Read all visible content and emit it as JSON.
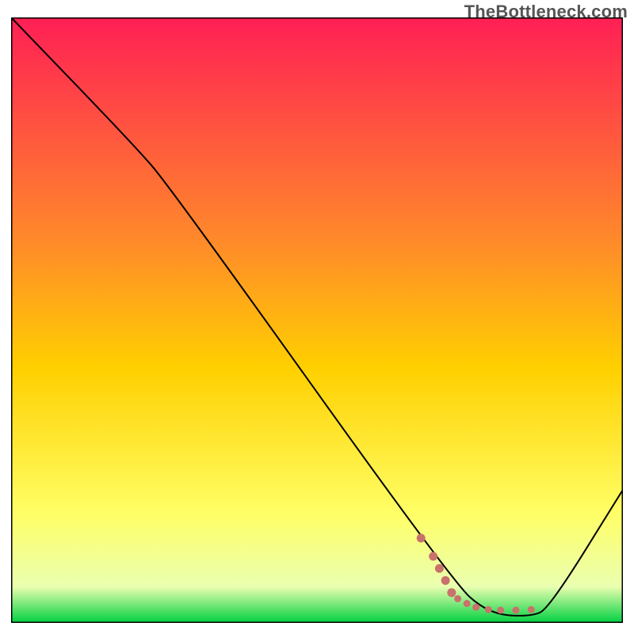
{
  "watermark": "TheBottleneck.com",
  "chart_data": {
    "type": "line",
    "title": "",
    "xlabel": "",
    "ylabel": "",
    "xlim": [
      0,
      100
    ],
    "ylim": [
      0,
      100
    ],
    "grid": false,
    "legend": null,
    "background_gradient": {
      "top": "#ff1f55",
      "mid": "#ffd000",
      "low": "#ffff66",
      "bottom": "#00d040"
    },
    "series": [
      {
        "name": "bottleneck-curve",
        "stroke": "#000000",
        "points": [
          {
            "x": 0,
            "y": 100
          },
          {
            "x": 20,
            "y": 79
          },
          {
            "x": 26,
            "y": 72
          },
          {
            "x": 72,
            "y": 7
          },
          {
            "x": 78,
            "y": 1.5
          },
          {
            "x": 85,
            "y": 1.0
          },
          {
            "x": 88,
            "y": 2.5
          },
          {
            "x": 100,
            "y": 22
          }
        ]
      }
    ],
    "markers": [
      {
        "name": "dotted-valley-segment",
        "color": "#c9716b",
        "points": [
          {
            "x": 67,
            "y": 14
          },
          {
            "x": 69,
            "y": 11
          },
          {
            "x": 70,
            "y": 9
          },
          {
            "x": 71,
            "y": 7
          },
          {
            "x": 72,
            "y": 5
          },
          {
            "x": 73,
            "y": 4
          },
          {
            "x": 74.5,
            "y": 3.2
          },
          {
            "x": 76,
            "y": 2.6
          },
          {
            "x": 78,
            "y": 2.2
          },
          {
            "x": 80,
            "y": 2.1
          },
          {
            "x": 82.5,
            "y": 2.1
          },
          {
            "x": 85,
            "y": 2.2
          }
        ]
      }
    ]
  }
}
